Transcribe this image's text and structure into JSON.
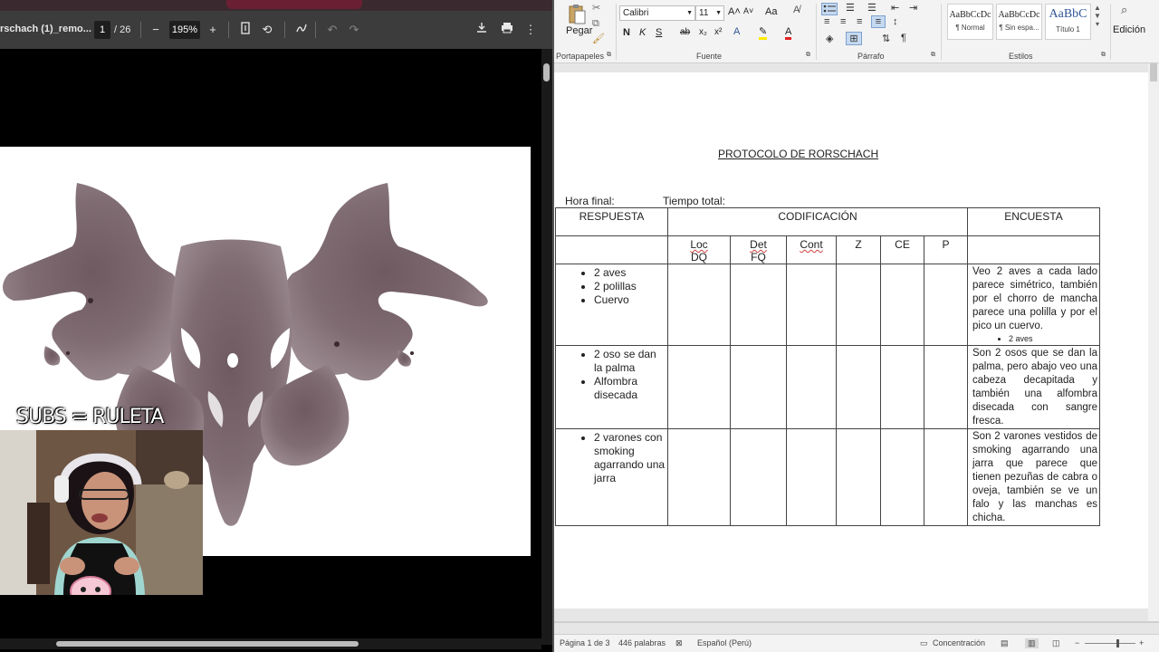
{
  "pdf_viewer": {
    "filename": "rschach (1)_remo...",
    "page_current": "1",
    "page_total": "/ 26",
    "zoom": "195%",
    "icons": [
      "minus-icon",
      "plus-icon",
      "fit-page-icon",
      "rotate-icon",
      "annotate-icon",
      "undo-icon",
      "redo-icon",
      "download-icon",
      "print-icon",
      "more-vert-icon"
    ]
  },
  "stream_overlay": {
    "subs_text": "SUBS = RULETA"
  },
  "word": {
    "ribbon": {
      "paste_label": "Pegar",
      "clipboard_group": "Portapapeles",
      "font_name": "Calibri",
      "font_size": "11",
      "font_group": "Fuente",
      "paragraph_group": "Párrafo",
      "styles_group": "Estilos",
      "editing_label": "Edición",
      "format_buttons": [
        "N",
        "K",
        "S",
        "ab",
        "x₂",
        "x²"
      ],
      "font_size_up": "A˄",
      "font_size_down": "A˅",
      "change_case": "Aa",
      "styles": [
        {
          "preview": "AaBbCcDc",
          "name": "¶ Normal"
        },
        {
          "preview": "AaBbCcDc",
          "name": "¶ Sin espa..."
        },
        {
          "preview": "AaBbC",
          "name": "Título 1"
        }
      ]
    },
    "document": {
      "title": "PROTOCOLO DE RORSCHACH",
      "hora_final": "Hora final:",
      "tiempo_total": "Tiempo total:",
      "headers": {
        "respuesta": "RESPUESTA",
        "codificacion": "CODIFICACIÓN",
        "encuesta": "ENCUESTA"
      },
      "subheaders": {
        "loc": "Loc",
        "dq": "DQ",
        "det": "Det",
        "fq": "FQ",
        "cont": "Cont",
        "z": "Z",
        "ce": "CE",
        "p": "P"
      },
      "rows": [
        {
          "responses": [
            "2 aves",
            "2 polillas",
            "Cuervo"
          ],
          "encuesta": "Veo 2 aves a cada lado parece simétrico, también por el chorro de mancha parece una polilla y por el pico un cuervo.",
          "encuesta_bullet": "2 aves"
        },
        {
          "responses": [
            "2 oso se dan la palma",
            "Alfombra disecada"
          ],
          "encuesta": "Son 2 osos que se dan la palma, pero abajo veo una cabeza decapitada y también una alfombra disecada con sangre fresca."
        },
        {
          "responses": [
            "2 varones con smoking agarrando una jarra"
          ],
          "encuesta": "Son 2 varones vestidos de smoking agarrando una jarra que parece que tienen pezuñas de cabra o oveja, también se ve un falo y las manchas es chicha."
        }
      ]
    },
    "statusbar": {
      "page": "Página 1 de 3",
      "words": "446 palabras",
      "language": "Español (Perú)",
      "focus": "Concentración"
    }
  }
}
